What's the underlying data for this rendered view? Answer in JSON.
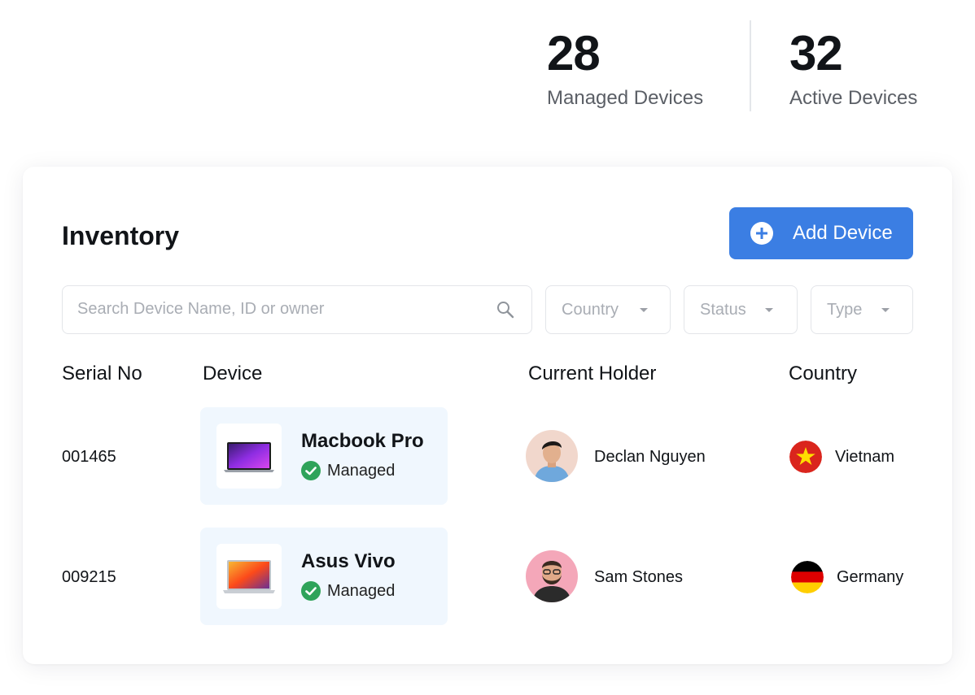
{
  "stats": [
    {
      "value": "28",
      "label": "Managed Devices"
    },
    {
      "value": "32",
      "label": "Active Devices"
    }
  ],
  "inventory": {
    "title": "Inventory",
    "add_button_label": "Add Device",
    "search_placeholder": "Search Device Name, ID or owner",
    "filters": [
      "Country",
      "Status",
      "Type"
    ],
    "columns": [
      "Serial No",
      "Device",
      "Current Holder",
      "Country"
    ],
    "rows": [
      {
        "serial": "001465",
        "device": "Macbook Pro",
        "status": "Managed",
        "holder": "Declan Nguyen",
        "country": "Vietnam"
      },
      {
        "serial": "009215",
        "device": "Asus Vivo",
        "status": "Managed",
        "holder": "Sam Stones",
        "country": "Germany"
      }
    ]
  },
  "colors": {
    "accent": "#3b7ee3",
    "managed_green": "#2fa35a",
    "device_card_bg": "#f0f7fe"
  },
  "icons": {
    "add": "plus-circle-icon",
    "search": "magnifier-icon",
    "dropdown": "caret-down-icon",
    "status": "check-circle-icon"
  }
}
